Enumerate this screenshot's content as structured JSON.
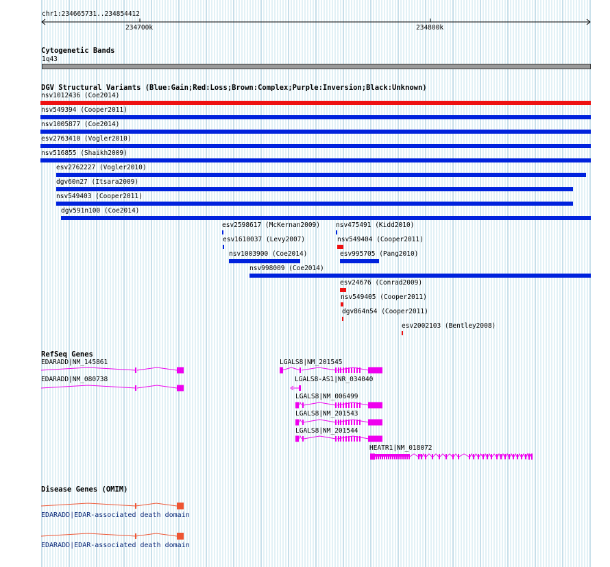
{
  "ruler": {
    "position": "chr1:234665731..234854412",
    "ticks": [
      "234700k",
      "234800k"
    ]
  },
  "cytoband": {
    "title": "Cytogenetic Bands",
    "band": "1q43"
  },
  "dgv": {
    "title": "DGV Structural Variants (Blue:Gain;Red:Loss;Brown:Complex;Purple:Inversion;Black:Unknown)",
    "colors": {
      "gain": "#0022dd",
      "loss": "#ee1111"
    },
    "variants": [
      {
        "label": "nsv1012436 (Coe2014)",
        "type": "loss"
      },
      {
        "label": "nsv549394 (Cooper2011)",
        "type": "gain"
      },
      {
        "label": "nsv1005877 (Coe2014)",
        "type": "gain"
      },
      {
        "label": "esv2763410 (Vogler2010)",
        "type": "gain"
      },
      {
        "label": "nsv516855 (Shaikh2009)",
        "type": "gain"
      },
      {
        "label": "esv2762227 (Vogler2010)",
        "type": "gain"
      },
      {
        "label": "dgv60n27 (Itsara2009)",
        "type": "gain"
      },
      {
        "label": "nsv549403 (Cooper2011)",
        "type": "gain"
      },
      {
        "label": "dgv591n100 (Coe2014)",
        "type": "gain"
      },
      {
        "label": "esv2598617 (McKernan2009)",
        "type": "gain"
      },
      {
        "label": "nsv475491 (Kidd2010)",
        "type": "gain"
      },
      {
        "label": "esv1610037 (Levy2007)",
        "type": "gain"
      },
      {
        "label": "nsv549404 (Cooper2011)",
        "type": "loss"
      },
      {
        "label": "nsv1003900 (Coe2014)",
        "type": "gain"
      },
      {
        "label": "esv995705 (Pang2010)",
        "type": "gain"
      },
      {
        "label": "nsv998009 (Coe2014)",
        "type": "gain"
      },
      {
        "label": "esv24676 (Conrad2009)",
        "type": "loss"
      },
      {
        "label": "nsv549405 (Cooper2011)",
        "type": "loss"
      },
      {
        "label": "dgv864n54 (Cooper2011)",
        "type": "loss"
      },
      {
        "label": "esv2002103 (Bentley2008)",
        "type": "loss"
      }
    ]
  },
  "refseq": {
    "title": "RefSeq Genes",
    "color": "#ee00ee",
    "genes": [
      {
        "label": "EDARADD|NM_145861"
      },
      {
        "label": "EDARADD|NM_080738"
      },
      {
        "label": "LGALS8|NM_201545"
      },
      {
        "label": "LGALS8-AS1|NR_034040"
      },
      {
        "label": "LGALS8|NM_006499"
      },
      {
        "label": "LGALS8|NM_201543"
      },
      {
        "label": "LGALS8|NM_201544"
      },
      {
        "label": "HEATR1|NM_018072"
      }
    ]
  },
  "omim": {
    "title": "Disease Genes (OMIM)",
    "color": "#ee5533",
    "genes": [
      {
        "label": "EDARADD|EDAR-associated death domain"
      },
      {
        "label": "EDARADD|EDAR-associated death domain"
      }
    ]
  }
}
